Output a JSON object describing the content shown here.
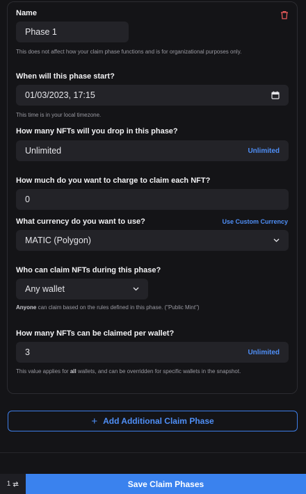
{
  "name_section": {
    "label": "Name",
    "value": "Phase 1",
    "help": "This does not affect how your claim phase functions and is for organizational purposes only."
  },
  "start_section": {
    "label": "When will this phase start?",
    "value": "01/03/2023, 17:15",
    "help": "This time is in your local timezone."
  },
  "drop_section": {
    "label": "How many NFTs will you drop in this phase?",
    "value": "Unlimited",
    "unlimited_link": "Unlimited"
  },
  "price_section": {
    "label": "How much do you want to charge to claim each NFT?",
    "value": "0"
  },
  "currency_section": {
    "label": "What currency do you want to use?",
    "custom_link": "Use Custom Currency",
    "selected": "MATIC (Polygon)"
  },
  "who_section": {
    "label": "Who can claim NFTs during this phase?",
    "selected": "Any wallet",
    "help_bold": "Anyone",
    "help_rest": " can claim based on the rules defined in this phase. (\"Public Mint\")"
  },
  "per_wallet_section": {
    "label": "How many NFTs can be claimed per wallet?",
    "value": "3",
    "unlimited_link": "Unlimited",
    "help_pre": "This value applies for ",
    "help_bold": "all",
    "help_post": " wallets, and can be overridden for specific wallets in the snapshot."
  },
  "add_phase_button": {
    "icon": "+",
    "label": "Add Additional Claim Phase"
  },
  "footer": {
    "counter": "1",
    "save_label": "Save Claim Phases"
  },
  "colors": {
    "accent": "#4f8ff7",
    "save_button": "#3a82ee",
    "background": "#141417",
    "input": "#232328"
  },
  "icons": {
    "delete": "trash-icon",
    "calendar": "calendar-icon",
    "dropdown": "chevron-down-icon",
    "add": "plus-icon",
    "counter": "arrows-swap-icon"
  }
}
